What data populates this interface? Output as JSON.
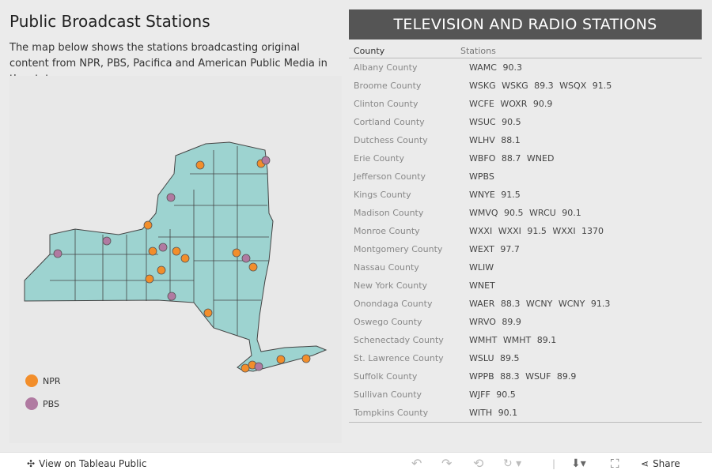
{
  "title": "Public Broadcast Stations",
  "description": "The map below shows the stations broadcasting original content from NPR, PBS, Pacifica and American Public Media in the state.",
  "legend": [
    {
      "label": "NPR",
      "color": "#f28e2b"
    },
    {
      "label": "PBS",
      "color": "#b07aa1"
    }
  ],
  "colors": {
    "map_fill": "#9dd3d0",
    "map_stroke": "#444444",
    "header_bg": "#555555"
  },
  "table": {
    "header": "TELEVISION AND RADIO STATIONS",
    "columns": [
      "County",
      "Stations"
    ],
    "rows": [
      {
        "county": "Albany County",
        "stations": "WAMC 90.3"
      },
      {
        "county": "Broome County",
        "stations": "WSKG  WSKG 89.3  WSQX 91.5"
      },
      {
        "county": "Clinton County",
        "stations": "WCFE  WOXR 90.9"
      },
      {
        "county": "Cortland County",
        "stations": "WSUC 90.5"
      },
      {
        "county": "Dutchess County",
        "stations": "WLHV 88.1"
      },
      {
        "county": "Erie County",
        "stations": "WBFO 88.7  WNED"
      },
      {
        "county": "Jefferson County",
        "stations": "WPBS"
      },
      {
        "county": "Kings County",
        "stations": "WNYE 91.5"
      },
      {
        "county": "Madison County",
        "stations": "WMVQ 90.5  WRCU 90.1"
      },
      {
        "county": "Monroe County",
        "stations": "WXXI  WXXI 91.5  WXXI 1370"
      },
      {
        "county": "Montgomery County",
        "stations": "WEXT 97.7"
      },
      {
        "county": "Nassau County",
        "stations": "WLIW"
      },
      {
        "county": "New York County",
        "stations": "WNET"
      },
      {
        "county": "Onondaga County",
        "stations": "WAER 88.3  WCNY  WCNY 91.3"
      },
      {
        "county": "Oswego County",
        "stations": "WRVO 89.9"
      },
      {
        "county": "Schenectady County",
        "stations": "WMHT  WMHT 89.1"
      },
      {
        "county": "St. Lawrence County",
        "stations": "WSLU 89.5"
      },
      {
        "county": "Suffolk County",
        "stations": "WPPB 88.3  WSUF 89.9"
      },
      {
        "county": "Sullivan County",
        "stations": "WJFF 90.5"
      },
      {
        "county": "Tompkins County",
        "stations": "WITH 90.1"
      }
    ]
  },
  "footer": {
    "view_label": "View on Tableau Public",
    "share_label": "Share"
  }
}
